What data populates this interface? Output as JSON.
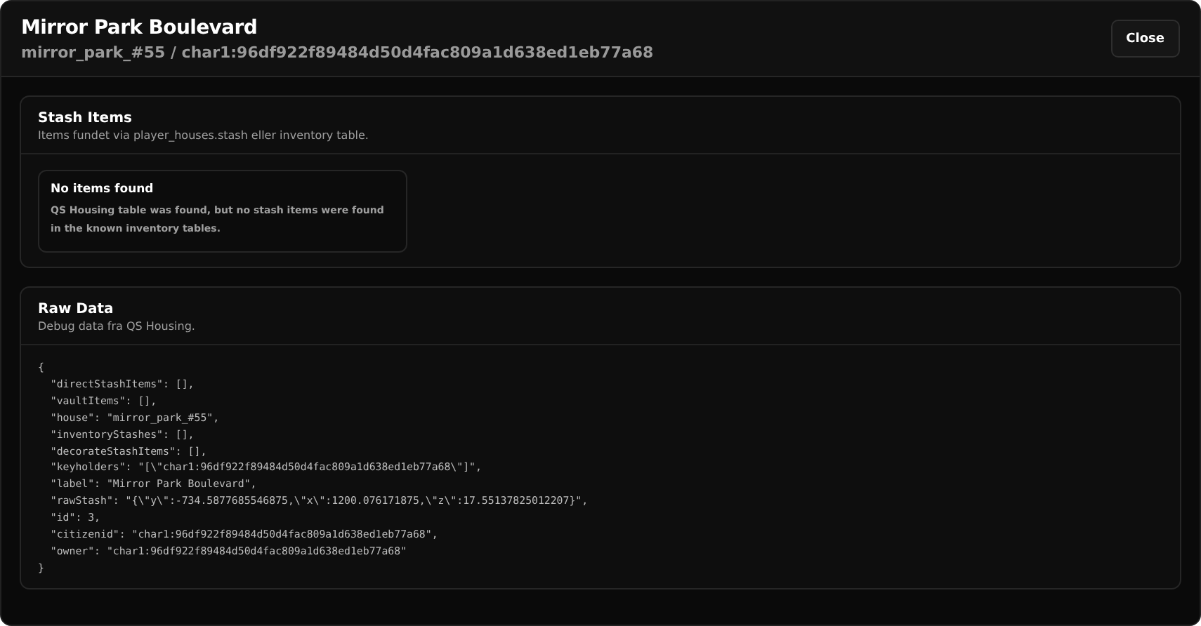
{
  "header": {
    "title": "Mirror Park Boulevard",
    "subtitle": "mirror_park_#55 / char1:96df922f89484d50d4fac809a1d638ed1eb77a68",
    "close_button": "Close"
  },
  "stash_section": {
    "title": "Stash Items",
    "subtitle": "Items fundet via player_houses.stash eller inventory table.",
    "empty_state": {
      "title": "No items found",
      "message": "QS Housing table was found, but no stash items were found in the known inventory tables."
    }
  },
  "raw_section": {
    "title": "Raw Data",
    "subtitle": "Debug data fra QS Housing.",
    "code_lines": [
      "{",
      "  \"directStashItems\": [],",
      "  \"vaultItems\": [],",
      "  \"house\": \"mirror_park_#55\",",
      "  \"inventoryStashes\": [],",
      "  \"decorateStashItems\": [],",
      "  \"keyholders\": \"[\\\"char1:96df922f89484d50d4fac809a1d638ed1eb77a68\\\"]\",",
      "  \"label\": \"Mirror Park Boulevard\",",
      "  \"rawStash\": \"{\\\"y\\\":-734.5877685546875,\\\"x\\\":1200.076171875,\\\"z\\\":17.55137825012207}\",",
      "  \"id\": 3,",
      "  \"citizenid\": \"char1:96df922f89484d50d4fac809a1d638ed1eb77a68\",",
      "  \"owner\": \"char1:96df922f89484d50d4fac809a1d638ed1eb77a68\"",
      "}"
    ]
  }
}
